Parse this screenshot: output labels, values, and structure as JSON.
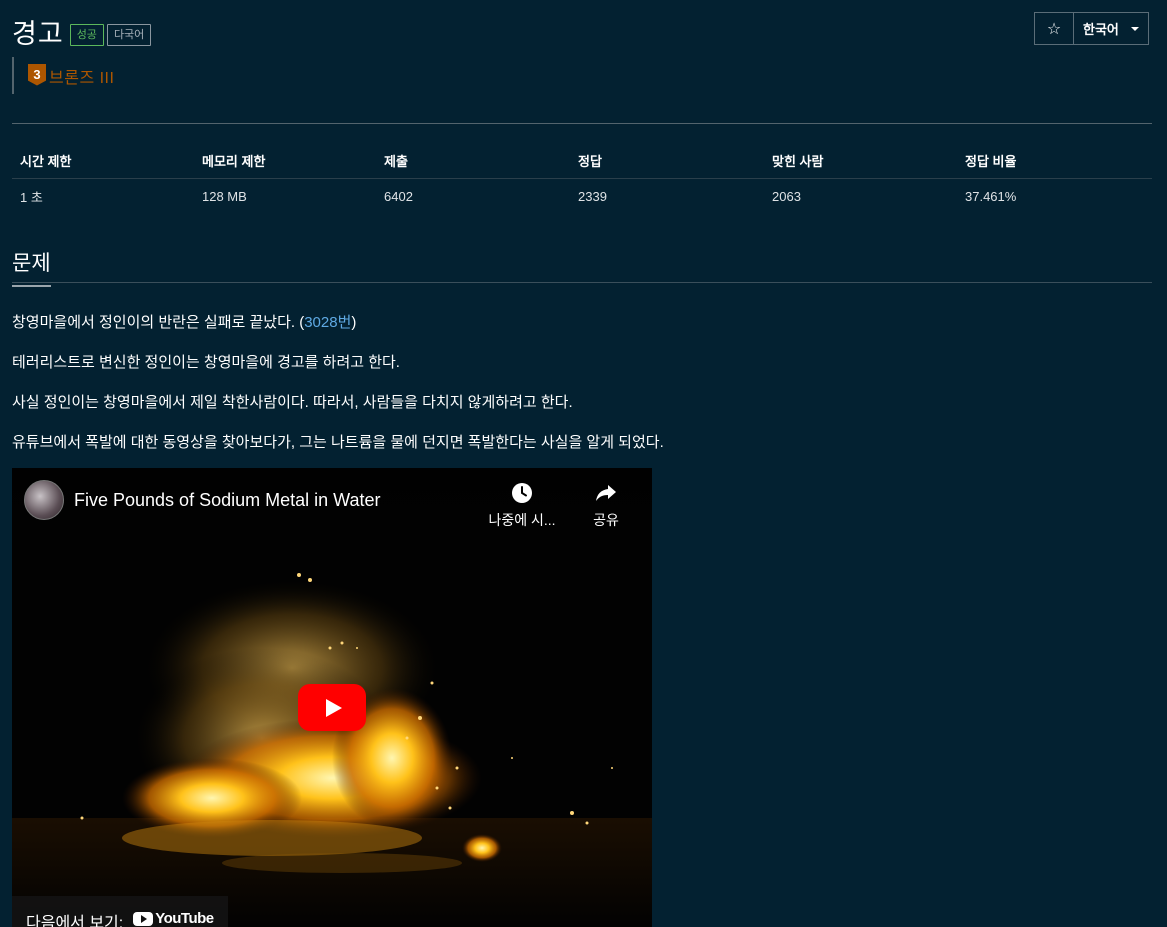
{
  "problem": {
    "title": "경고",
    "badges": {
      "status": "성공",
      "language": "다국어"
    },
    "tier": {
      "number": "3",
      "label": "브론즈 III"
    }
  },
  "header_tools": {
    "star_glyph": "☆",
    "language_select": "한국어"
  },
  "info_table": {
    "headers": [
      "시간 제한",
      "메모리 제한",
      "제출",
      "정답",
      "맞힌 사람",
      "정답 비율"
    ],
    "values": [
      "1 초",
      "128 MB",
      "6402",
      "2339",
      "2063",
      "37.461%"
    ]
  },
  "section": {
    "title": "문제"
  },
  "description": {
    "line1_before": "창영마을에서 정인이의 반란은 실패로 끝났다. (",
    "line1_link": "3028번",
    "line1_after": ")",
    "line2": "테러리스트로 변신한 정인이는 창영마을에 경고를 하려고 한다.",
    "line3": "사실 정인이는 창영마을에서 제일 착한사람이다. 따라서, 사람들을 다치지 않게하려고 한다.",
    "line4": "유튜브에서 폭발에 대한 동영상을 찾아보다가, 그는 나트륨을 물에 던지면 폭발한다는 사실을 알게 되었다."
  },
  "video": {
    "title": "Five Pounds of Sodium Metal in Water",
    "watch_later_label": "나중에 시...",
    "share_label": "공유",
    "watch_on_label": "다음에서 보기:",
    "youtube_label": "YouTube"
  },
  "colors": {
    "background": "#032131",
    "success": "#5cb85c",
    "bronze": "#ad5600",
    "link": "#5fa9e3",
    "play_button": "#ff0000"
  },
  "icons": [
    "star-icon",
    "caret-down-icon",
    "bronze-tier-icon",
    "clock-icon",
    "share-icon",
    "play-icon",
    "youtube-logo-icon"
  ]
}
